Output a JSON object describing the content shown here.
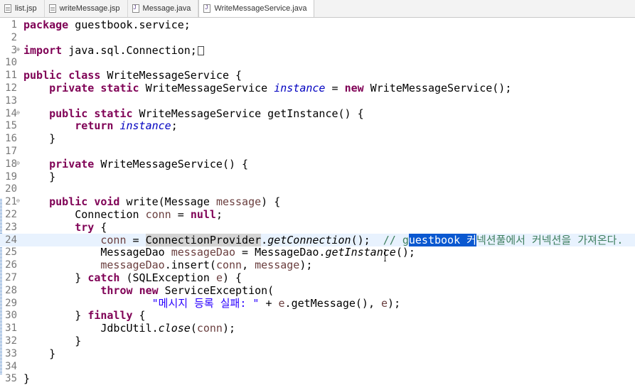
{
  "tabs": [
    {
      "label": "list.jsp",
      "icon": "jsp-file-icon"
    },
    {
      "label": "writeMessage.jsp",
      "icon": "jsp-file-icon"
    },
    {
      "label": "Message.java",
      "icon": "java-file-icon"
    },
    {
      "label": "WriteMessageService.java",
      "icon": "java-file-icon",
      "active": true
    }
  ],
  "lines": [
    {
      "n": "1",
      "tokens": [
        {
          "t": "package",
          "c": "kw"
        },
        {
          "t": " guestbook.service;"
        }
      ]
    },
    {
      "n": "2",
      "tokens": []
    },
    {
      "n": "3",
      "fold": "plus",
      "tokens": [
        {
          "t": "import",
          "c": "kw"
        },
        {
          "t": " java.sql.Connection;"
        },
        {
          "box": true
        }
      ]
    },
    {
      "n": "10",
      "tokens": []
    },
    {
      "n": "11",
      "tokens": [
        {
          "t": "public",
          "c": "kw"
        },
        {
          "t": " "
        },
        {
          "t": "class",
          "c": "kw"
        },
        {
          "t": " WriteMessageService {"
        }
      ]
    },
    {
      "n": "12",
      "tokens": [
        {
          "t": "    "
        },
        {
          "t": "private",
          "c": "kw"
        },
        {
          "t": " "
        },
        {
          "t": "static",
          "c": "kw"
        },
        {
          "t": " WriteMessageService "
        },
        {
          "t": "instance",
          "c": "field"
        },
        {
          "t": " = "
        },
        {
          "t": "new",
          "c": "kw"
        },
        {
          "t": " WriteMessageService();"
        }
      ]
    },
    {
      "n": "13",
      "tokens": []
    },
    {
      "n": "14",
      "fold": "minus",
      "tokens": [
        {
          "t": "    "
        },
        {
          "t": "public",
          "c": "kw"
        },
        {
          "t": " "
        },
        {
          "t": "static",
          "c": "kw"
        },
        {
          "t": " WriteMessageService getInstance() {"
        }
      ]
    },
    {
      "n": "15",
      "tokens": [
        {
          "t": "        "
        },
        {
          "t": "return",
          "c": "kw"
        },
        {
          "t": " "
        },
        {
          "t": "instance",
          "c": "field"
        },
        {
          "t": ";"
        }
      ]
    },
    {
      "n": "16",
      "tokens": [
        {
          "t": "    }"
        }
      ]
    },
    {
      "n": "17",
      "tokens": []
    },
    {
      "n": "18",
      "fold": "minus",
      "tokens": [
        {
          "t": "    "
        },
        {
          "t": "private",
          "c": "kw"
        },
        {
          "t": " WriteMessageService() {"
        }
      ]
    },
    {
      "n": "19",
      "tokens": [
        {
          "t": "    }"
        }
      ]
    },
    {
      "n": "20",
      "tokens": []
    },
    {
      "n": "21",
      "fold": "minus",
      "tokens": [
        {
          "t": "    "
        },
        {
          "t": "public",
          "c": "kw"
        },
        {
          "t": " "
        },
        {
          "t": "void",
          "c": "kw"
        },
        {
          "t": " write(Message "
        },
        {
          "t": "message",
          "c": "var"
        },
        {
          "t": ") {"
        }
      ]
    },
    {
      "n": "22",
      "tokens": [
        {
          "t": "        Connection "
        },
        {
          "t": "conn",
          "c": "var"
        },
        {
          "t": " = "
        },
        {
          "t": "null",
          "c": "kw"
        },
        {
          "t": ";"
        }
      ]
    },
    {
      "n": "23",
      "tokens": [
        {
          "t": "        "
        },
        {
          "t": "try",
          "c": "kw"
        },
        {
          "t": " {"
        }
      ]
    },
    {
      "n": "24",
      "current": true,
      "tokens": [
        {
          "t": "            "
        },
        {
          "t": "conn",
          "c": "var"
        },
        {
          "t": " = "
        },
        {
          "t": "ConnectionProvider",
          "c": "occ"
        },
        {
          "t": "."
        },
        {
          "t": "getConnection",
          "c": "it"
        },
        {
          "t": "();  "
        },
        {
          "t": "// g",
          "c": "cm"
        },
        {
          "t": "uestbook ",
          "c": "sel"
        },
        {
          "t": "커",
          "c": "sel"
        },
        {
          "t": "넥션풀에서 커넥션을 가져온다.",
          "c": "cm"
        }
      ]
    },
    {
      "n": "25",
      "tokens": [
        {
          "t": "            MessageDao "
        },
        {
          "t": "messageDao",
          "c": "var"
        },
        {
          "t": " = MessageDao."
        },
        {
          "t": "getInstance",
          "c": "it"
        },
        {
          "t": "();"
        }
      ]
    },
    {
      "n": "26",
      "tokens": [
        {
          "t": "            "
        },
        {
          "t": "messageDao",
          "c": "var"
        },
        {
          "t": ".insert("
        },
        {
          "t": "conn",
          "c": "var"
        },
        {
          "t": ", "
        },
        {
          "t": "message",
          "c": "var"
        },
        {
          "t": ");"
        }
      ]
    },
    {
      "n": "27",
      "tokens": [
        {
          "t": "        } "
        },
        {
          "t": "catch",
          "c": "kw"
        },
        {
          "t": " (SQLException "
        },
        {
          "t": "e",
          "c": "var"
        },
        {
          "t": ") {"
        }
      ]
    },
    {
      "n": "28",
      "tokens": [
        {
          "t": "            "
        },
        {
          "t": "throw",
          "c": "kw"
        },
        {
          "t": " "
        },
        {
          "t": "new",
          "c": "kw"
        },
        {
          "t": " ServiceException("
        }
      ]
    },
    {
      "n": "29",
      "tokens": [
        {
          "t": "                    "
        },
        {
          "t": "\"메시지 등록 실패: \"",
          "c": "str"
        },
        {
          "t": " + "
        },
        {
          "t": "e",
          "c": "var"
        },
        {
          "t": ".getMessage(), "
        },
        {
          "t": "e",
          "c": "var"
        },
        {
          "t": ");"
        }
      ]
    },
    {
      "n": "30",
      "tokens": [
        {
          "t": "        } "
        },
        {
          "t": "finally",
          "c": "kw"
        },
        {
          "t": " {"
        }
      ]
    },
    {
      "n": "31",
      "tokens": [
        {
          "t": "            JdbcUtil."
        },
        {
          "t": "close",
          "c": "it"
        },
        {
          "t": "("
        },
        {
          "t": "conn",
          "c": "var"
        },
        {
          "t": ");"
        }
      ]
    },
    {
      "n": "32",
      "tokens": [
        {
          "t": "        }"
        }
      ]
    },
    {
      "n": "33",
      "tokens": [
        {
          "t": "    }"
        }
      ]
    },
    {
      "n": "34",
      "tokens": []
    },
    {
      "n": "35",
      "tokens": [
        {
          "t": "}"
        }
      ]
    }
  ]
}
